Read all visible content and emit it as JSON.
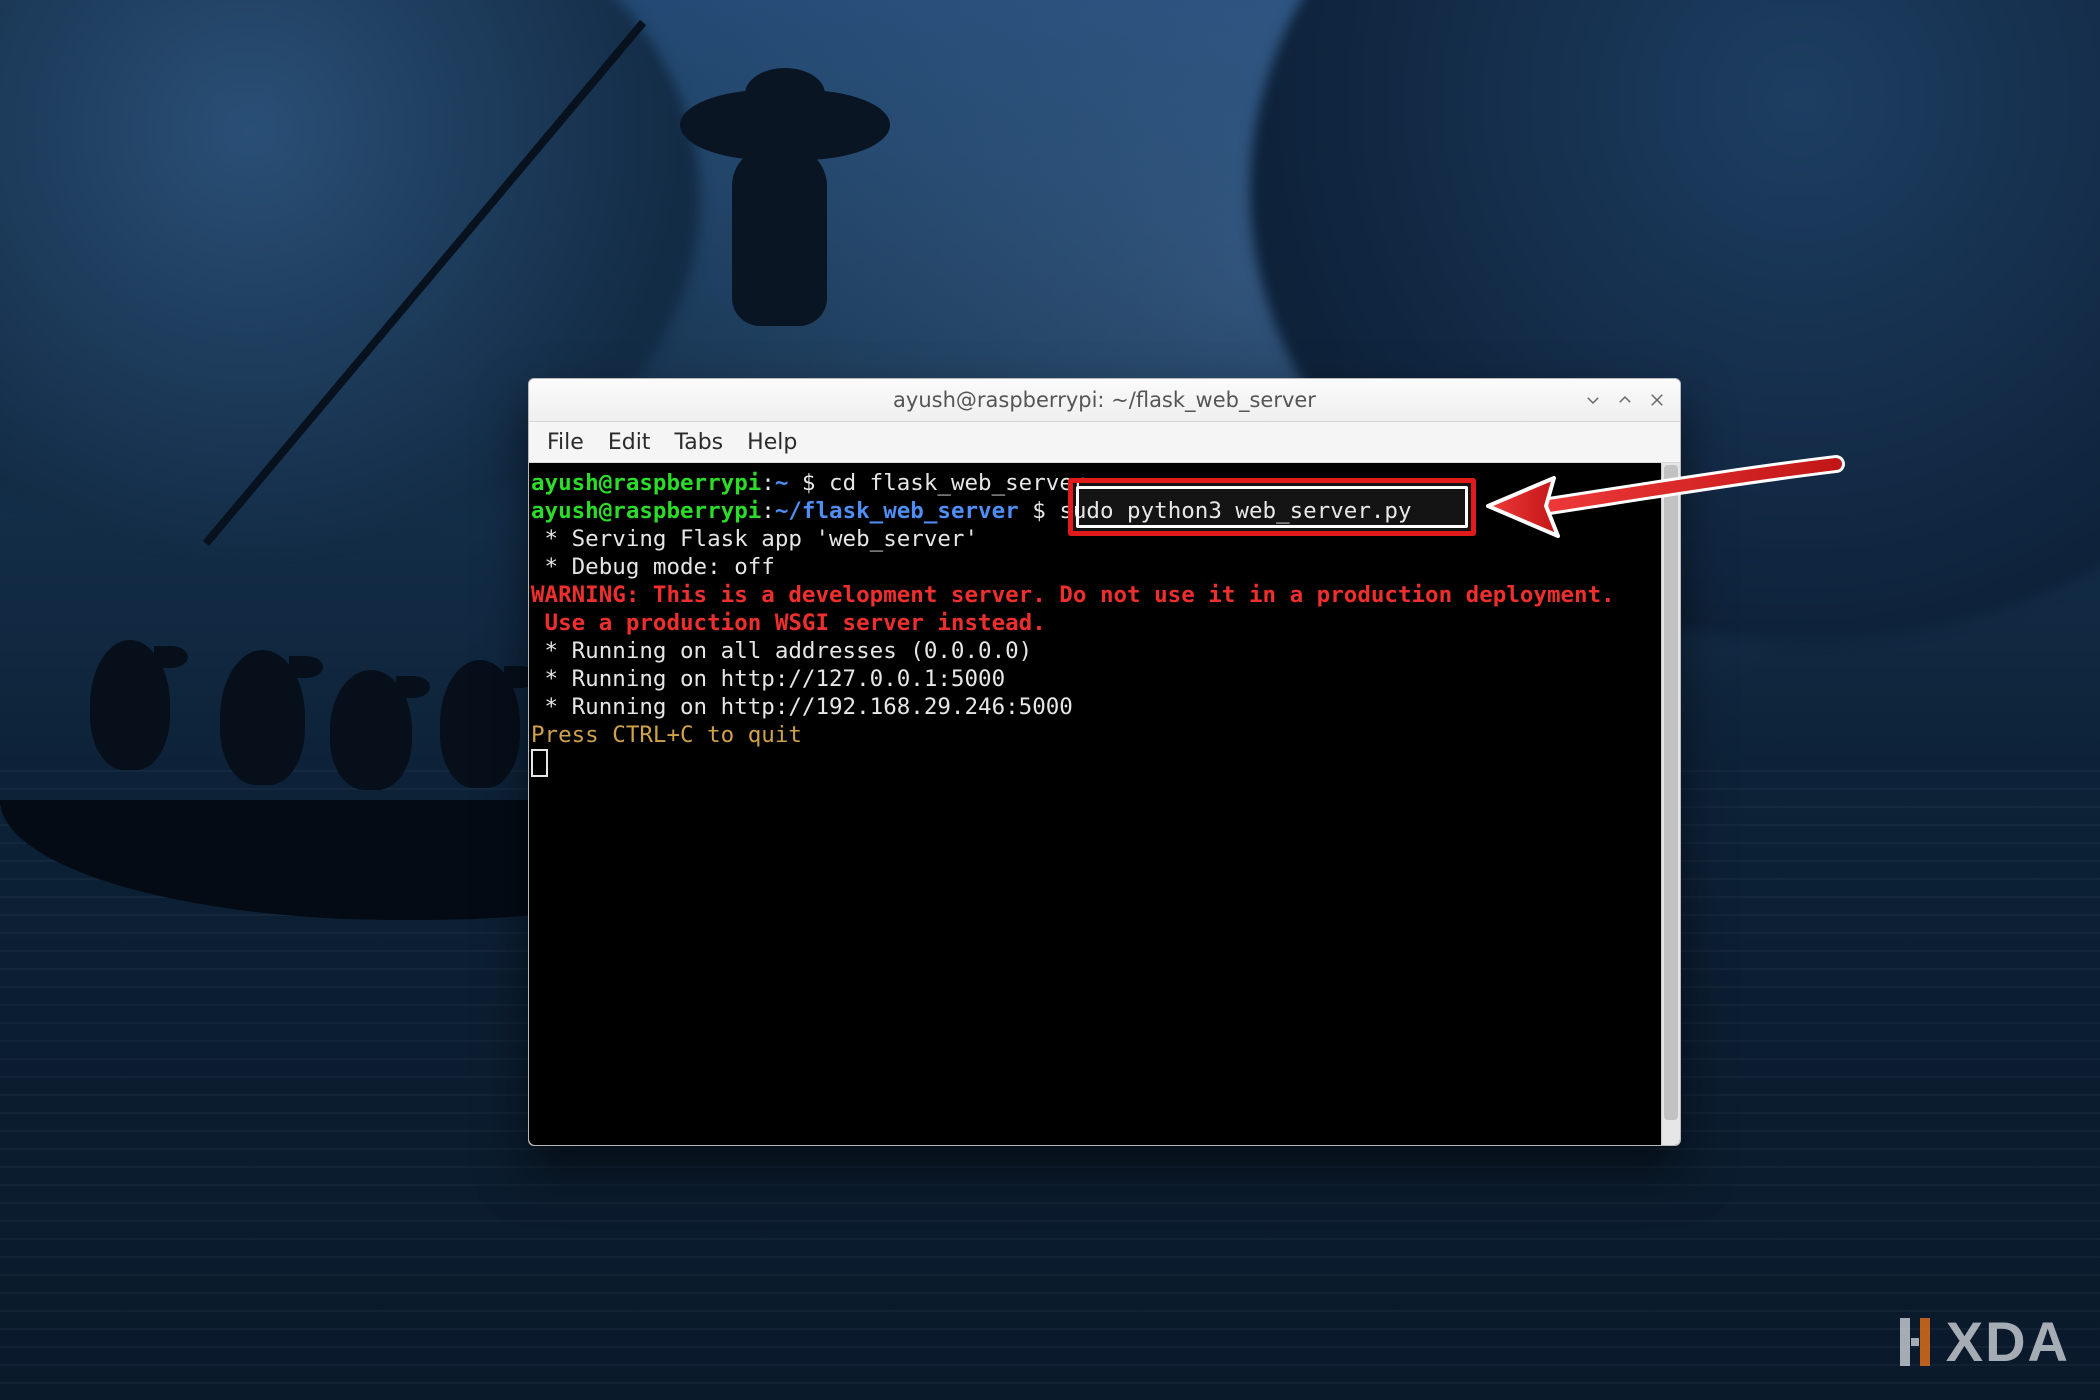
{
  "window": {
    "title": "ayush@raspberrypi: ~/flask_web_server",
    "menus": {
      "file": "File",
      "edit": "Edit",
      "tabs": "Tabs",
      "help": "Help"
    }
  },
  "terminal": {
    "prompt1": {
      "userhost": "ayush@raspberrypi",
      "sep": ":",
      "path": "~",
      "dollar": " $ ",
      "cmd": "cd flask_web_server"
    },
    "prompt2": {
      "userhost": "ayush@raspberrypi",
      "sep": ":",
      "path": "~/flask_web_server",
      "dollar": " $ ",
      "cmd": "sudo python3 web_server.py"
    },
    "lines": {
      "serving": " * Serving Flask app 'web_server'",
      "debug": " * Debug mode: off",
      "warn1": "WARNING: This is a development server. Do not use it in a production deployment.",
      "warn2": " Use a production WSGI server instead.",
      "all": " * Running on all addresses (0.0.0.0)",
      "local": " * Running on http://127.0.0.1:5000",
      "lan": " * Running on http://192.168.29.246:5000",
      "quit": "Press CTRL+C to quit"
    }
  },
  "annotation": {
    "highlighted_command": "sudo python3 web_server.py"
  },
  "watermark": {
    "text": "XDA"
  }
}
